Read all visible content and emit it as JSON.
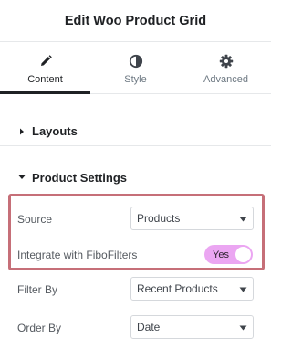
{
  "header": {
    "title": "Edit Woo Product Grid"
  },
  "tabs": [
    {
      "label": "Content",
      "icon": "pencil-icon",
      "active": true
    },
    {
      "label": "Style",
      "icon": "contrast-icon",
      "active": false
    },
    {
      "label": "Advanced",
      "icon": "gear-icon",
      "active": false
    }
  ],
  "sections": {
    "layouts": {
      "title": "Layouts",
      "expanded": false
    },
    "product_settings": {
      "title": "Product Settings",
      "expanded": true
    }
  },
  "fields": {
    "source": {
      "label": "Source",
      "value": "Products"
    },
    "integrate": {
      "label": "Integrate with FiboFilters",
      "value": "Yes",
      "on": true
    },
    "filter_by": {
      "label": "Filter By",
      "value": "Recent Products"
    },
    "order_by": {
      "label": "Order By",
      "value": "Date"
    }
  },
  "colors": {
    "highlight": "#c66f78",
    "toggle_on": "#eba6f2",
    "active_tab": "#1f2124"
  }
}
